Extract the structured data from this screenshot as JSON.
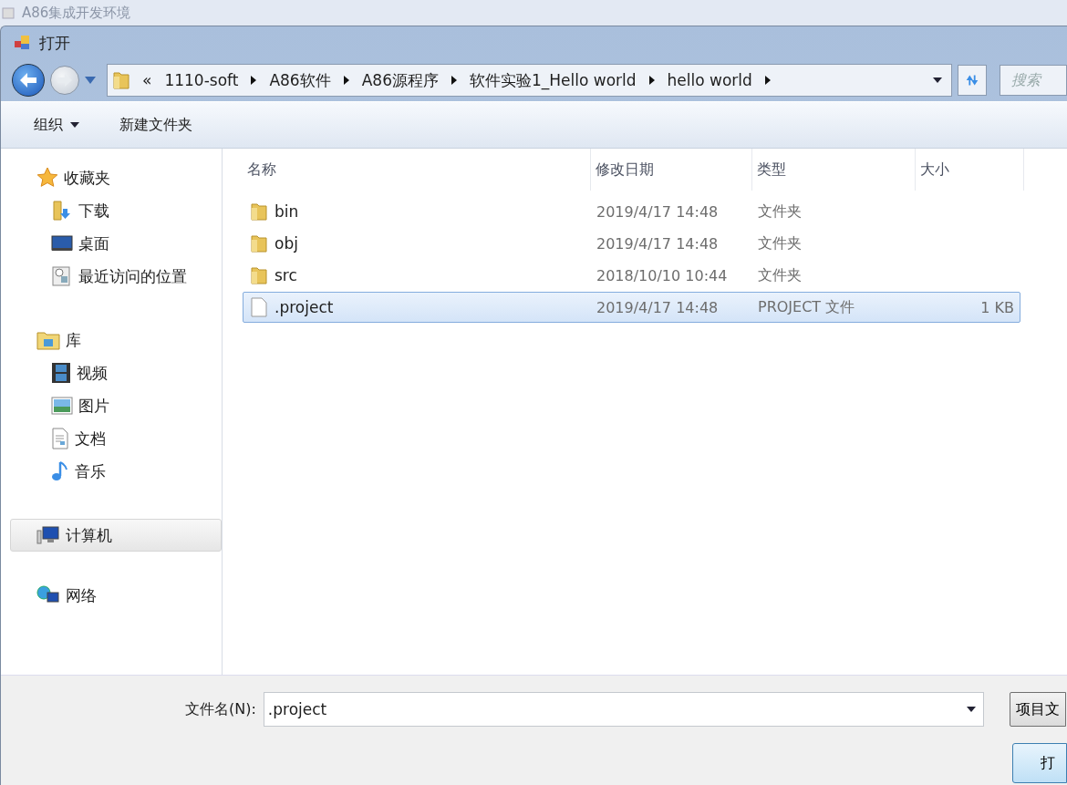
{
  "background_window": {
    "title": "A86集成开发环境"
  },
  "dialog": {
    "title": "打开"
  },
  "address_bar": {
    "overflow": "«",
    "crumbs": [
      "1110-soft",
      "A86软件",
      "A86源程序",
      "软件实验1_Hello world",
      "hello world"
    ]
  },
  "search": {
    "placeholder": "搜索"
  },
  "toolbar": {
    "items": [
      {
        "label": "组织",
        "kind": "menu"
      },
      {
        "label": "新建文件夹",
        "kind": "plain"
      }
    ]
  },
  "sidebar": {
    "groups": [
      {
        "label": "收藏夹",
        "selected": false,
        "children": [
          {
            "label": "下载",
            "selected": false
          },
          {
            "label": "桌面",
            "selected": false
          },
          {
            "label": "最近访问的位置",
            "selected": false
          }
        ]
      },
      {
        "label": "库",
        "selected": false,
        "children": [
          {
            "label": "视频",
            "selected": false
          },
          {
            "label": "图片",
            "selected": false
          },
          {
            "label": "文档",
            "selected": false
          },
          {
            "label": "音乐",
            "selected": false
          }
        ]
      },
      {
        "label": "计算机",
        "selected": true
      },
      {
        "label": "网络",
        "selected": false
      }
    ]
  },
  "table": {
    "columns": [
      "名称",
      "修改日期",
      "类型",
      "大小"
    ],
    "rows": [
      {
        "kind": "folder",
        "name": "bin",
        "modified": "2019/4/17 14:48",
        "type": "文件夹",
        "selected": false
      },
      {
        "kind": "folder",
        "name": "obj",
        "modified": "2019/4/17 14:48",
        "type": "文件夹",
        "selected": false
      },
      {
        "kind": "folder",
        "name": "src",
        "modified": "2018/10/10 10:44",
        "type": "文件夹",
        "selected": false
      },
      {
        "kind": "file",
        "name": ".project",
        "modified": "2019/4/17 14:48",
        "type": "PROJECT 文件",
        "size": "1 KB",
        "selected": true
      }
    ]
  },
  "footer": {
    "filename_label": "文件名(N):",
    "filename_value": ".project",
    "filter": "项目文",
    "open_button": "打"
  }
}
